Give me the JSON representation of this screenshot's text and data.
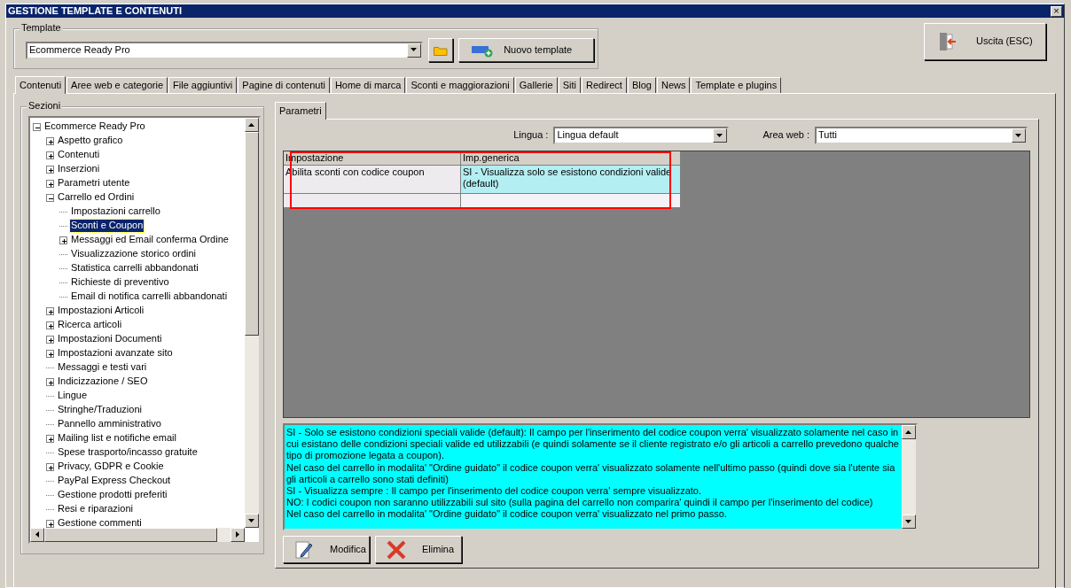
{
  "window": {
    "title": "GESTIONE TEMPLATE E CONTENUTI",
    "close": "×"
  },
  "template_group": {
    "legend": "Template",
    "value": "Ecommerce Ready Pro",
    "new_button": "Nuovo template"
  },
  "exit_button": "Uscita (ESC)",
  "tabs": [
    {
      "label": "Contenuti",
      "selected": true
    },
    {
      "label": "Aree web e categorie",
      "selected": false
    },
    {
      "label": "File aggiuntivi",
      "selected": false
    },
    {
      "label": "Pagine di contenuti",
      "selected": false
    },
    {
      "label": "Home di marca",
      "selected": false
    },
    {
      "label": "Sconti e maggiorazioni",
      "selected": false
    },
    {
      "label": "Gallerie",
      "selected": false
    },
    {
      "label": "Siti",
      "selected": false
    },
    {
      "label": "Redirect",
      "selected": false
    },
    {
      "label": "Blog",
      "selected": false
    },
    {
      "label": "News",
      "selected": false
    },
    {
      "label": "Template e plugins",
      "selected": false
    }
  ],
  "sections": {
    "legend": "Sezioni",
    "tree": [
      {
        "label": "Ecommerce Ready Pro",
        "kind": "folder",
        "expanded": true,
        "selected": false,
        "children": [
          {
            "label": "Aspetto grafico",
            "kind": "folder",
            "expanded": false,
            "selected": false
          },
          {
            "label": "Contenuti",
            "kind": "folder",
            "expanded": false,
            "selected": false
          },
          {
            "label": "Inserzioni",
            "kind": "folder",
            "expanded": false,
            "selected": false
          },
          {
            "label": "Parametri utente",
            "kind": "folder",
            "expanded": false,
            "selected": false
          },
          {
            "label": "Carrello ed Ordini",
            "kind": "folder",
            "expanded": true,
            "selected": false,
            "children": [
              {
                "label": "Impostazioni carrello",
                "kind": "leaf",
                "selected": false
              },
              {
                "label": "Sconti e Coupon",
                "kind": "leaf",
                "selected": true
              },
              {
                "label": "Messaggi ed Email conferma Ordine",
                "kind": "folder",
                "expanded": false,
                "selected": false
              },
              {
                "label": "Visualizzazione storico ordini",
                "kind": "leaf",
                "selected": false
              },
              {
                "label": "Statistica carrelli abbandonati",
                "kind": "leaf",
                "selected": false
              },
              {
                "label": "Richieste di preventivo",
                "kind": "leaf",
                "selected": false
              },
              {
                "label": "Email di notifica carrelli abbandonati",
                "kind": "leaf",
                "selected": false
              }
            ]
          },
          {
            "label": "Impostazioni Articoli",
            "kind": "folder",
            "expanded": false,
            "selected": false
          },
          {
            "label": "Ricerca articoli",
            "kind": "folder",
            "expanded": false,
            "selected": false
          },
          {
            "label": "Impostazioni Documenti",
            "kind": "folder",
            "expanded": false,
            "selected": false
          },
          {
            "label": "Impostazioni avanzate sito",
            "kind": "folder",
            "expanded": false,
            "selected": false
          },
          {
            "label": "Messaggi e testi vari",
            "kind": "leaf",
            "selected": false
          },
          {
            "label": "Indicizzazione / SEO",
            "kind": "folder",
            "expanded": false,
            "selected": false
          },
          {
            "label": "Lingue",
            "kind": "leaf",
            "selected": false
          },
          {
            "label": "Stringhe/Traduzioni",
            "kind": "leaf",
            "selected": false
          },
          {
            "label": "Pannello amministrativo",
            "kind": "leaf",
            "selected": false
          },
          {
            "label": "Mailing list e notifiche email",
            "kind": "folder",
            "expanded": false,
            "selected": false
          },
          {
            "label": "Spese trasporto/incasso gratuite",
            "kind": "leaf",
            "selected": false
          },
          {
            "label": "Privacy, GDPR e Cookie",
            "kind": "folder",
            "expanded": false,
            "selected": false
          },
          {
            "label": "PayPal Express Checkout",
            "kind": "leaf",
            "selected": false
          },
          {
            "label": "Gestione prodotti preferiti",
            "kind": "leaf",
            "selected": false
          },
          {
            "label": "Resi e riparazioni",
            "kind": "leaf",
            "selected": false
          },
          {
            "label": "Gestione commenti",
            "kind": "folder",
            "expanded": false,
            "selected": false
          }
        ]
      }
    ]
  },
  "params_tab": {
    "label": "Parametri",
    "selected": true
  },
  "filters": {
    "language_label": "Lingua :",
    "language_value": "Lingua default",
    "area_label": "Area web :",
    "area_value": "Tutti"
  },
  "grid": {
    "columns": [
      "Impostazione",
      "Imp.generica"
    ],
    "rows": [
      {
        "cells": [
          "Abilita sconti con codice coupon",
          "SI - Visualizza solo se esistono condizioni valide (default)"
        ],
        "selected": true
      }
    ]
  },
  "description": [
    "SI - Solo se esistono condizioni speciali valide (default): Il campo per l'inserimento del codice coupon verra' visualizzato solamente nel caso in cui esistano delle condizioni speciali valide ed utilizzabili (e quindi solamente se il cliente registrato e/o gli articoli a carrello prevedono qualche tipo di promozione legata a coupon).",
    "Nel caso del carrello in modalita' \"Ordine guidato\" il codice coupon verra' visualizzato solamente nell'ultimo passo (quindi dove sia l'utente sia gli articoli a carrello sono stati definiti)",
    "SI - Visualizza sempre : Il campo per l'inserimento del codice coupon verra' sempre visualizzato.",
    "NO: I codici coupon non saranno utilizzabili sul sito (sulla pagina del carrello non comparira' quindi il campo per l'inserimento del codice)",
    "Nel caso del carrello in modalita' \"Ordine guidato\" il codice coupon verra' visualizzato nel primo passo."
  ],
  "buttons": [
    {
      "label": "Modifica",
      "kind": "edit"
    },
    {
      "label": "Elimina",
      "kind": "delete"
    }
  ]
}
